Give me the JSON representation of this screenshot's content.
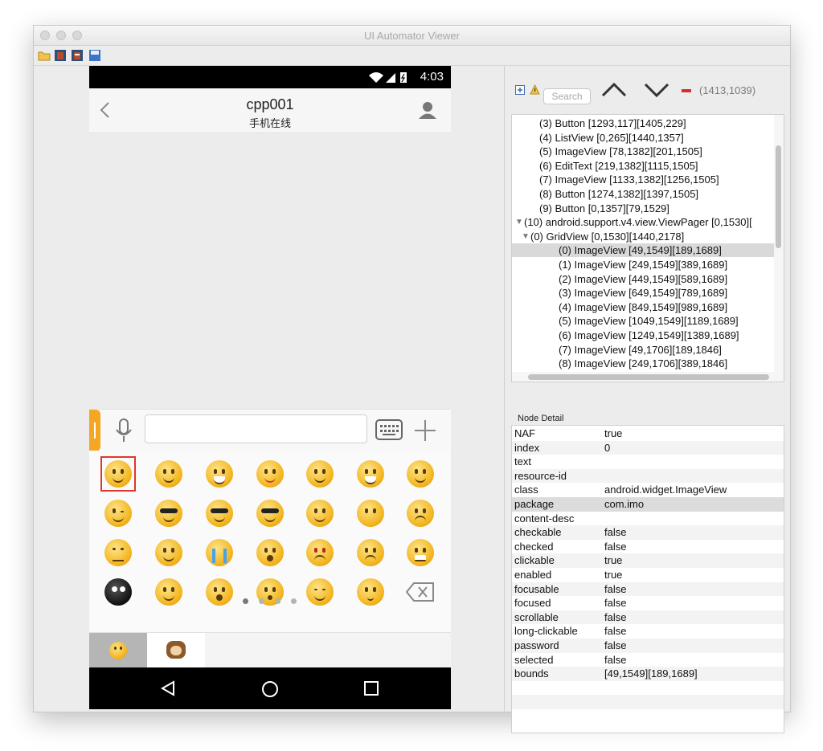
{
  "window": {
    "title": "UI Automator Viewer"
  },
  "device": {
    "status_time": "4:03",
    "contact_name": "cpp001",
    "contact_status": "手机在线"
  },
  "hierarchy": {
    "search_placeholder": "Search",
    "coords": "(1413,1039)",
    "rows": [
      {
        "text": "(3) Button [1293,117][1405,229]",
        "indent": 1,
        "expander": ""
      },
      {
        "text": "(4) ListView [0,265][1440,1357]",
        "indent": 1,
        "expander": ""
      },
      {
        "text": "(5) ImageView [78,1382][201,1505]",
        "indent": 1,
        "expander": ""
      },
      {
        "text": "(6) EditText [219,1382][1115,1505]",
        "indent": 1,
        "expander": ""
      },
      {
        "text": "(7) ImageView [1133,1382][1256,1505]",
        "indent": 1,
        "expander": ""
      },
      {
        "text": "(8) Button [1274,1382][1397,1505]",
        "indent": 1,
        "expander": ""
      },
      {
        "text": "(9) Button [0,1357][79,1529]",
        "indent": 1,
        "expander": ""
      },
      {
        "text": "(10) android.support.v4.view.ViewPager [0,1530][",
        "indent": 0,
        "expander": "▼"
      },
      {
        "text": "(0) GridView [0,1530][1440,2178]",
        "indent": 1,
        "expander": "▼"
      },
      {
        "text": "(0) ImageView [49,1549][189,1689]",
        "indent": 2,
        "expander": "",
        "selected": true
      },
      {
        "text": "(1) ImageView [249,1549][389,1689]",
        "indent": 2,
        "expander": ""
      },
      {
        "text": "(2) ImageView [449,1549][589,1689]",
        "indent": 2,
        "expander": ""
      },
      {
        "text": "(3) ImageView [649,1549][789,1689]",
        "indent": 2,
        "expander": ""
      },
      {
        "text": "(4) ImageView [849,1549][989,1689]",
        "indent": 2,
        "expander": ""
      },
      {
        "text": "(5) ImageView [1049,1549][1189,1689]",
        "indent": 2,
        "expander": ""
      },
      {
        "text": "(6) ImageView [1249,1549][1389,1689]",
        "indent": 2,
        "expander": ""
      },
      {
        "text": "(7) ImageView [49,1706][189,1846]",
        "indent": 2,
        "expander": ""
      },
      {
        "text": "(8) ImageView [249,1706][389,1846]",
        "indent": 2,
        "expander": ""
      }
    ]
  },
  "node_detail": {
    "label": "Node Detail",
    "props": [
      {
        "name": "NAF",
        "value": "true"
      },
      {
        "name": "index",
        "value": "0"
      },
      {
        "name": "text",
        "value": ""
      },
      {
        "name": "resource-id",
        "value": ""
      },
      {
        "name": "class",
        "value": "android.widget.ImageView"
      },
      {
        "name": "package",
        "value": "com.imo",
        "selected": true
      },
      {
        "name": "content-desc",
        "value": ""
      },
      {
        "name": "checkable",
        "value": "false"
      },
      {
        "name": "checked",
        "value": "false"
      },
      {
        "name": "clickable",
        "value": "true"
      },
      {
        "name": "enabled",
        "value": "true"
      },
      {
        "name": "focusable",
        "value": "false"
      },
      {
        "name": "focused",
        "value": "false"
      },
      {
        "name": "scrollable",
        "value": "false"
      },
      {
        "name": "long-clickable",
        "value": "false"
      },
      {
        "name": "password",
        "value": "false"
      },
      {
        "name": "selected",
        "value": "false"
      },
      {
        "name": "bounds",
        "value": "[49,1549][189,1689]"
      }
    ]
  },
  "colors": {
    "accent_orange": "#f5a623",
    "selection_red": "#e0372b",
    "tree_selection": "#d9d9d9"
  }
}
